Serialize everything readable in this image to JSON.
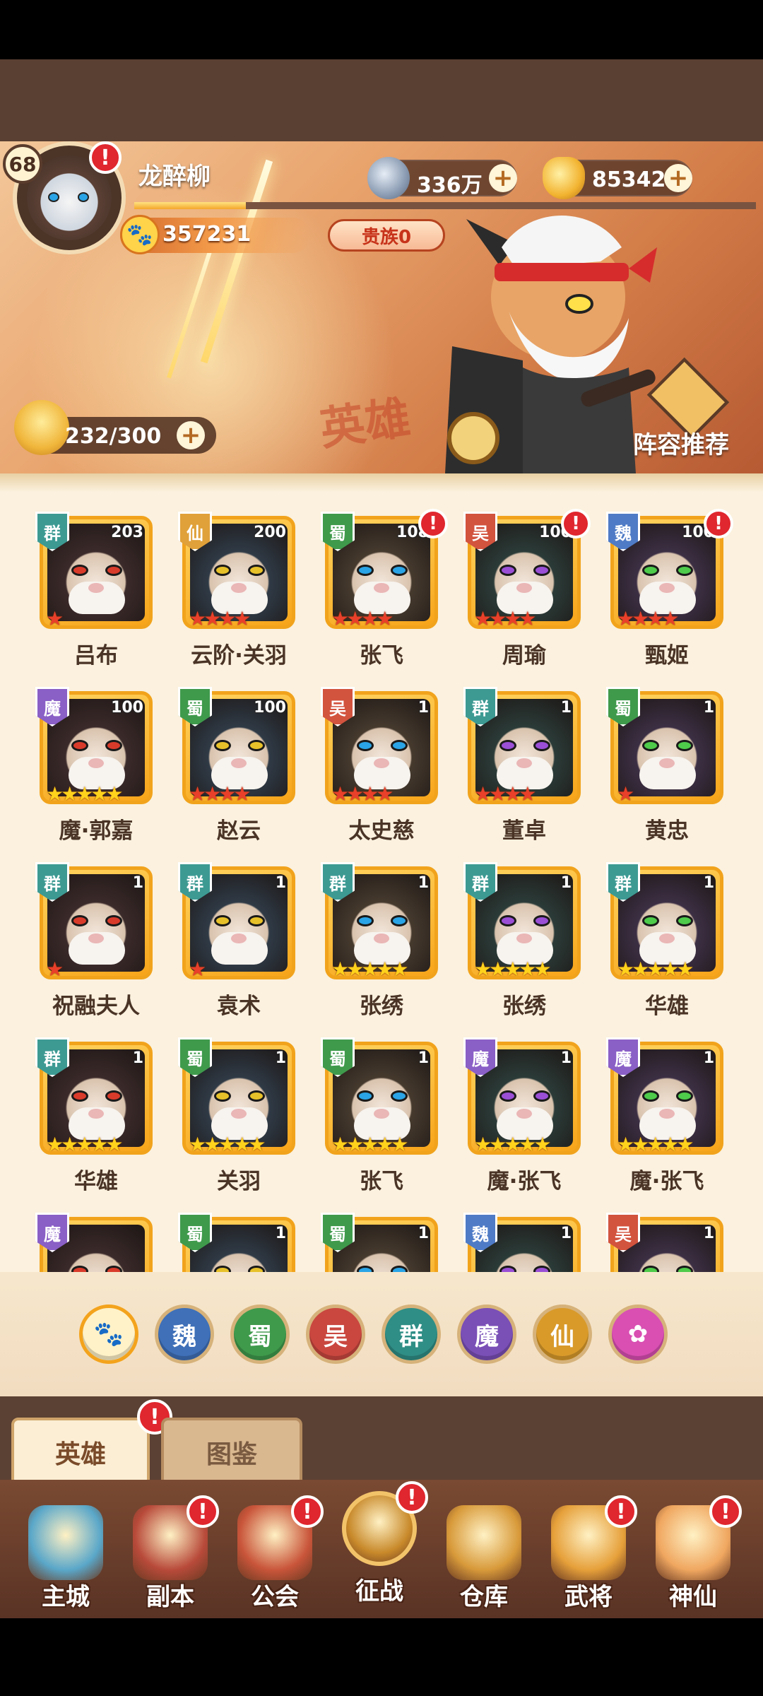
{
  "player": {
    "level": "68",
    "name": "龙醉柳",
    "xp_fraction": 0.18,
    "paw_value": "357231",
    "noble": "贵族0",
    "coins": "336万",
    "gold": "85342",
    "stamina": "232/300"
  },
  "banner": {
    "watermark": "英雄",
    "lineup_label": "阵容推荐"
  },
  "heroes": [
    {
      "name": "吕布",
      "faction": "群",
      "level": "203",
      "stars": 1,
      "star_color": "red",
      "alert": false
    },
    {
      "name": "云阶·关羽",
      "faction": "仙",
      "level": "200",
      "stars": 4,
      "star_color": "red",
      "alert": false
    },
    {
      "name": "张飞",
      "faction": "蜀",
      "level": "108",
      "stars": 4,
      "star_color": "red",
      "alert": true
    },
    {
      "name": "周瑜",
      "faction": "吴",
      "level": "100",
      "stars": 4,
      "star_color": "red",
      "alert": true
    },
    {
      "name": "甄姬",
      "faction": "魏",
      "level": "100",
      "stars": 4,
      "star_color": "red",
      "alert": true
    },
    {
      "name": "魔·郭嘉",
      "faction": "魔",
      "level": "100",
      "stars": 5,
      "star_color": "gold",
      "alert": false
    },
    {
      "name": "赵云",
      "faction": "蜀",
      "level": "100",
      "stars": 4,
      "star_color": "red",
      "alert": false
    },
    {
      "name": "太史慈",
      "faction": "吴",
      "level": "1",
      "stars": 4,
      "star_color": "red",
      "alert": false
    },
    {
      "name": "董卓",
      "faction": "群",
      "level": "1",
      "stars": 4,
      "star_color": "red",
      "alert": false
    },
    {
      "name": "黄忠",
      "faction": "蜀",
      "level": "1",
      "stars": 1,
      "star_color": "red",
      "alert": false
    },
    {
      "name": "祝融夫人",
      "faction": "群",
      "level": "1",
      "stars": 1,
      "star_color": "red",
      "alert": false
    },
    {
      "name": "袁术",
      "faction": "群",
      "level": "1",
      "stars": 1,
      "star_color": "red",
      "alert": false
    },
    {
      "name": "张绣",
      "faction": "群",
      "level": "1",
      "stars": 5,
      "star_color": "gold",
      "alert": false
    },
    {
      "name": "张绣",
      "faction": "群",
      "level": "1",
      "stars": 5,
      "star_color": "gold",
      "alert": false
    },
    {
      "name": "华雄",
      "faction": "群",
      "level": "1",
      "stars": 5,
      "star_color": "gold",
      "alert": false
    },
    {
      "name": "华雄",
      "faction": "群",
      "level": "1",
      "stars": 5,
      "star_color": "gold",
      "alert": false
    },
    {
      "name": "关羽",
      "faction": "蜀",
      "level": "1",
      "stars": 5,
      "star_color": "gold",
      "alert": false
    },
    {
      "name": "张飞",
      "faction": "蜀",
      "level": "1",
      "stars": 5,
      "star_color": "gold",
      "alert": false
    },
    {
      "name": "魔·张飞",
      "faction": "魔",
      "level": "1",
      "stars": 5,
      "star_color": "gold",
      "alert": false
    },
    {
      "name": "魔·张飞",
      "faction": "魔",
      "level": "1",
      "stars": 5,
      "star_color": "gold",
      "alert": false
    },
    {
      "name": "",
      "faction": "魔",
      "level": "",
      "stars": 0,
      "star_color": "gold",
      "alert": false
    },
    {
      "name": "",
      "faction": "蜀",
      "level": "1",
      "stars": 0,
      "star_color": "gold",
      "alert": false
    },
    {
      "name": "",
      "faction": "蜀",
      "level": "1",
      "stars": 0,
      "star_color": "gold",
      "alert": false
    },
    {
      "name": "",
      "faction": "魏",
      "level": "1",
      "stars": 0,
      "star_color": "gold",
      "alert": false
    },
    {
      "name": "",
      "faction": "吴",
      "level": "1",
      "stars": 0,
      "star_color": "gold",
      "alert": false
    }
  ],
  "faction_colors": {
    "群": "#3d9a93",
    "仙": "#e0a13a",
    "蜀": "#3f9a4c",
    "吴": "#d2533e",
    "魏": "#4f7bc6",
    "魔": "#8a5fc6"
  },
  "filters": [
    {
      "label": "paw-icon",
      "kind": "all",
      "color": "#fff2c8"
    },
    {
      "label": "魏",
      "color": "#3f70b8"
    },
    {
      "label": "蜀",
      "color": "#3f9a4c"
    },
    {
      "label": "吴",
      "color": "#c9473f"
    },
    {
      "label": "群",
      "color": "#2f8e86"
    },
    {
      "label": "魔",
      "color": "#7a4fb6"
    },
    {
      "label": "仙",
      "color": "#d99a2a"
    },
    {
      "label": "swirl-icon",
      "kind": "special",
      "color": "#d94fb2"
    }
  ],
  "tabs": {
    "active": "英雄",
    "inactive": "图鉴"
  },
  "nav": [
    {
      "label": "主城",
      "icon": "castle-icon",
      "alert": false
    },
    {
      "label": "副本",
      "icon": "sword-icon",
      "alert": true
    },
    {
      "label": "公会",
      "icon": "flag-icon",
      "alert": true
    },
    {
      "label": "征战",
      "icon": "battle-gate-icon",
      "alert": true,
      "center": true
    },
    {
      "label": "仓库",
      "icon": "bag-icon",
      "alert": false
    },
    {
      "label": "武将",
      "icon": "cat-general-icon",
      "alert": true
    },
    {
      "label": "神仙",
      "icon": "cat-immortal-icon",
      "alert": true
    }
  ],
  "alert_mark": "!"
}
